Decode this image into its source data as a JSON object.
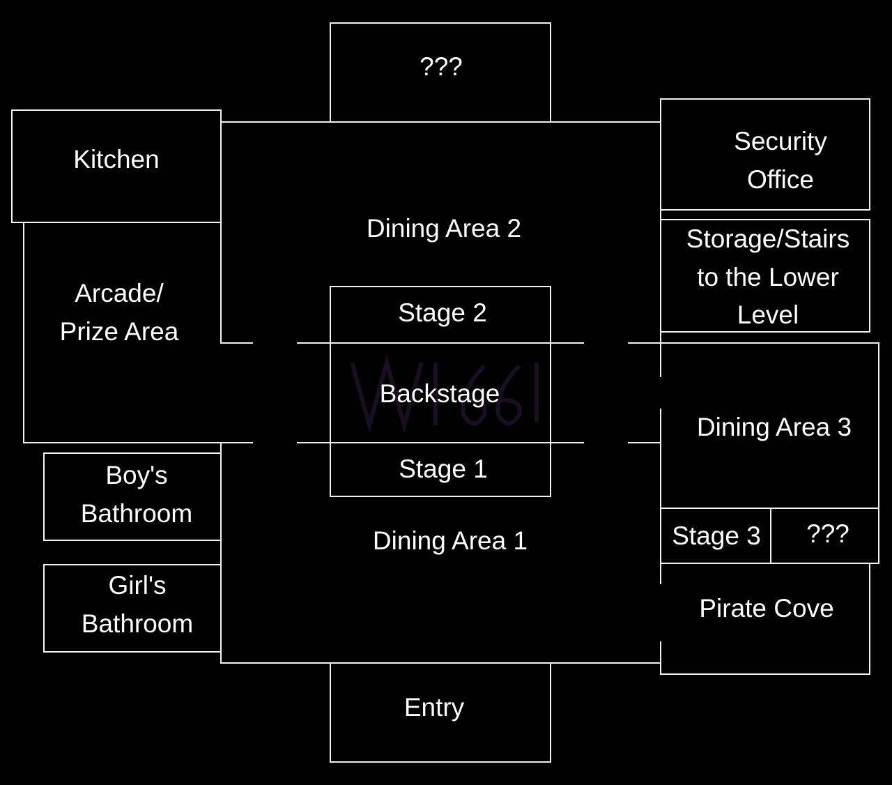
{
  "watermark": "W1661",
  "colors": {
    "background": "#000000",
    "walls": "#f2f2f2",
    "text": "#ffffff",
    "watermark": "#1a0f22"
  },
  "rooms": {
    "unknown_top": "???",
    "kitchen": "Kitchen",
    "dining_area_2": "Dining Area 2",
    "security_office": [
      "Security",
      "Office"
    ],
    "storage": [
      "Storage/Stairs",
      "to the Lower",
      "Level"
    ],
    "arcade": [
      "Arcade/",
      "Prize Area"
    ],
    "stage_2": "Stage 2",
    "backstage": "Backstage",
    "stage_1": "Stage 1",
    "dining_area_3": "Dining Area 3",
    "boys_bathroom": [
      "Boy's",
      "Bathroom"
    ],
    "girls_bathroom": [
      "Girl's",
      "Bathroom"
    ],
    "dining_area_1": "Dining Area 1",
    "stage_3": "Stage 3",
    "unknown_right": "???",
    "pirate_cove": "Pirate Cove",
    "entry": "Entry"
  }
}
